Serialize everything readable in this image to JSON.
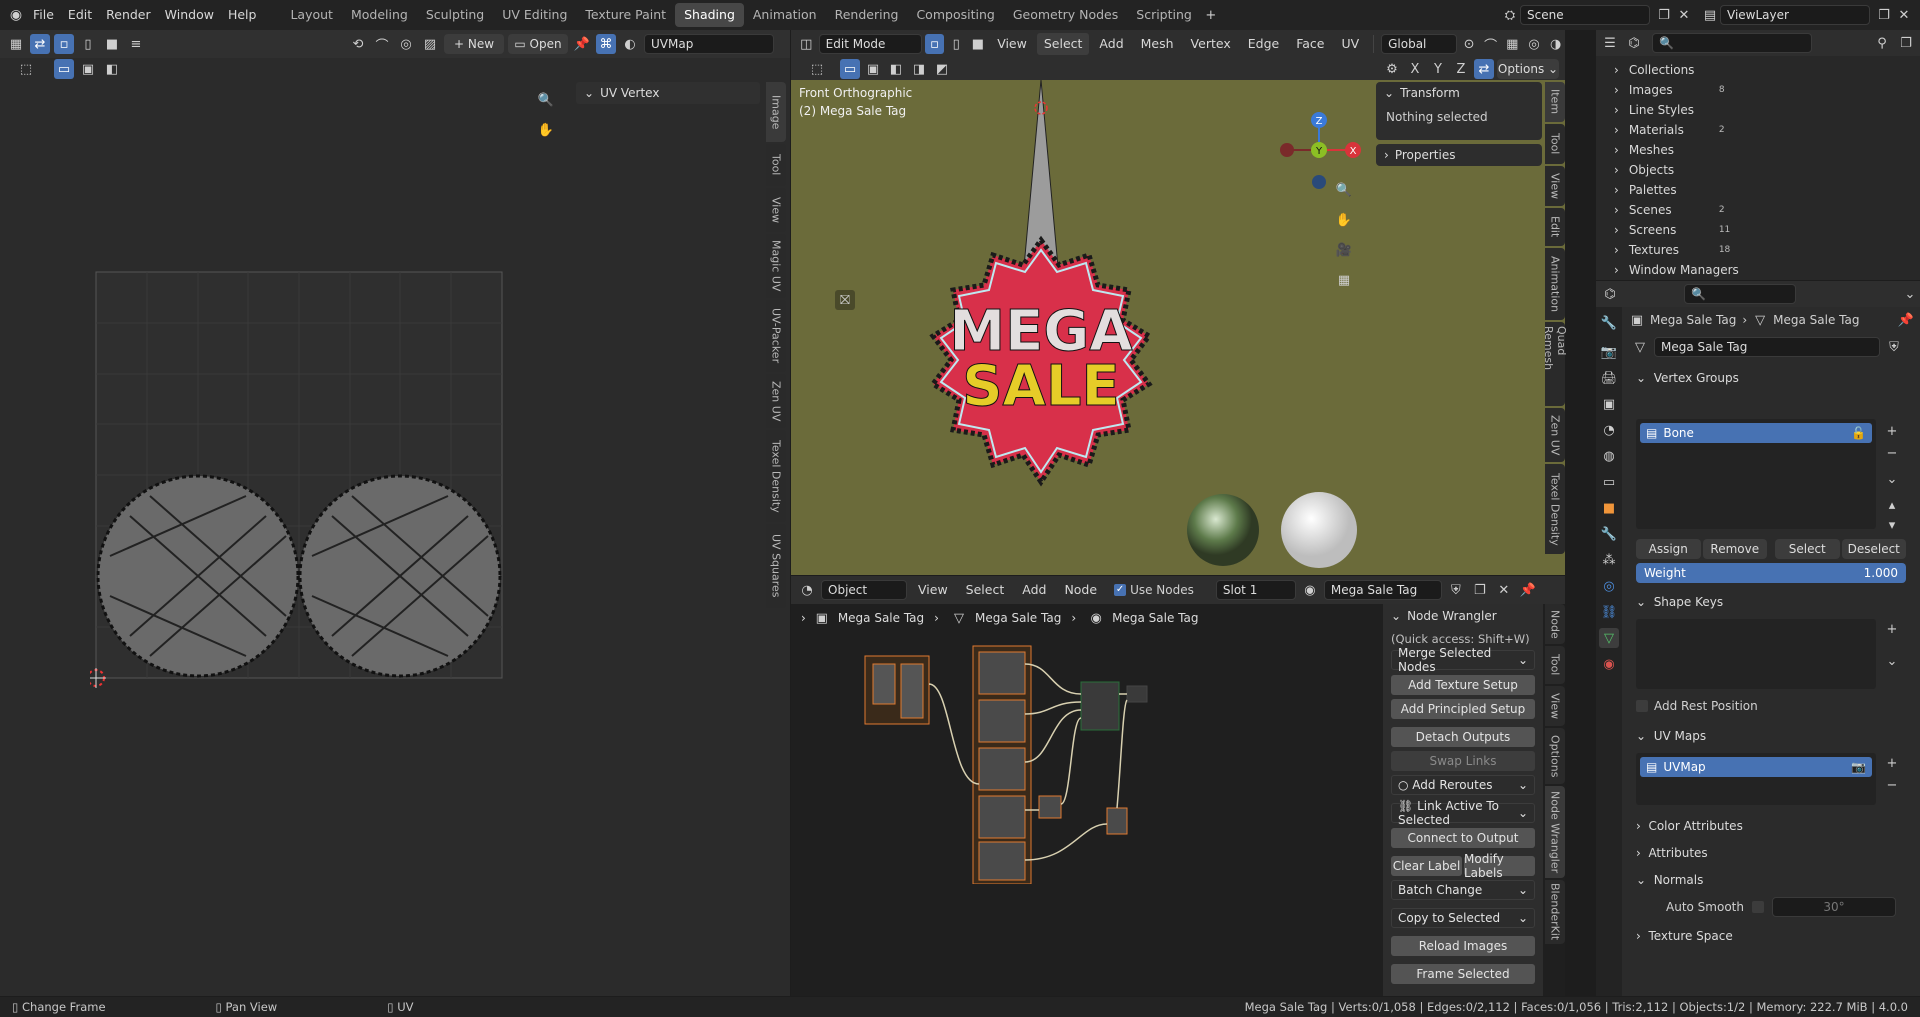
{
  "topbar": {
    "menus": [
      "File",
      "Edit",
      "Render",
      "Window",
      "Help"
    ],
    "workspaces": [
      "Layout",
      "Modeling",
      "Sculpting",
      "UV Editing",
      "Texture Paint",
      "Shading",
      "Animation",
      "Rendering",
      "Compositing",
      "Geometry Nodes",
      "Scripting"
    ],
    "active_workspace": "Shading",
    "scene_label": "Scene",
    "viewlayer_label": "ViewLayer"
  },
  "uv_editor": {
    "new_label": "New",
    "open_label": "Open",
    "uvmap_field": "UVMap",
    "side_panel_title": "UV Vertex",
    "side_tabs": [
      "Image",
      "Tool",
      "View",
      "Magic UV",
      "UV-Packer",
      "Zen UV",
      "Texel Density",
      "UV Squares"
    ]
  },
  "viewport": {
    "mode": "Edit Mode",
    "menus": [
      "View",
      "Select",
      "Add",
      "Mesh",
      "Vertex",
      "Edge",
      "Face",
      "UV"
    ],
    "transform_orientation": "Global",
    "options_label": "Options",
    "axis_x": "X",
    "axis_y": "Y",
    "axis_z": "Z",
    "view_name": "Front Orthographic",
    "object_name": "(2) Mega Sale Tag",
    "tag_text_top": "MEGA",
    "tag_text_bottom": "SALE",
    "transform_title": "Transform",
    "nothing_selected": "Nothing selected",
    "properties_title": "Properties",
    "side_tabs": [
      "Item",
      "Tool",
      "View",
      "Edit",
      "Animation",
      "Quad Remesh",
      "Zen UV",
      "Texel Density"
    ]
  },
  "node_editor": {
    "mode": "Object",
    "menus": [
      "View",
      "Select",
      "Add",
      "Node"
    ],
    "use_nodes_label": "Use Nodes",
    "slot": "Slot 1",
    "material": "Mega Sale Tag",
    "breadcrumb": [
      "Mega Sale Tag",
      "Mega Sale Tag",
      "Mega Sale Tag"
    ],
    "nw_title": "Node Wrangler",
    "nw_quick": "(Quick access: Shift+W)",
    "nw_merge": "Merge Selected Nodes",
    "nw_add_texture": "Add Texture Setup",
    "nw_add_principled": "Add Principled Setup",
    "nw_detach": "Detach Outputs",
    "nw_swap": "Swap Links",
    "nw_reroutes": "Add Reroutes",
    "nw_link_active": "Link Active To Selected",
    "nw_connect": "Connect to Output",
    "nw_clear_label": "Clear Label",
    "nw_modify_labels": "Modify Labels",
    "nw_batch": "Batch Change",
    "nw_copy": "Copy to Selected",
    "nw_reload": "Reload Images",
    "nw_frame": "Frame Selected",
    "side_tabs": [
      "Node",
      "Tool",
      "View",
      "Options",
      "Node Wrangler",
      "BlenderKit"
    ]
  },
  "outliner": {
    "items": [
      {
        "label": "Collections",
        "count": ""
      },
      {
        "label": "Images",
        "count": "8"
      },
      {
        "label": "Line Styles",
        "count": ""
      },
      {
        "label": "Materials",
        "count": "2"
      },
      {
        "label": "Meshes",
        "count": ""
      },
      {
        "label": "Objects",
        "count": ""
      },
      {
        "label": "Palettes",
        "count": ""
      },
      {
        "label": "Scenes",
        "count": "2"
      },
      {
        "label": "Screens",
        "count": "11"
      },
      {
        "label": "Textures",
        "count": "18"
      },
      {
        "label": "Window Managers",
        "count": ""
      }
    ]
  },
  "properties": {
    "breadcrumb_object": "Mega Sale Tag",
    "breadcrumb_mesh": "Mega Sale Tag",
    "mesh_name": "Mega Sale Tag",
    "vertex_groups_title": "Vertex Groups",
    "vertex_group_item": "Bone",
    "assign": "Assign",
    "remove": "Remove",
    "select": "Select",
    "deselect": "Deselect",
    "weight_label": "Weight",
    "weight_value": "1.000",
    "shape_keys_title": "Shape Keys",
    "add_rest_position": "Add Rest Position",
    "uv_maps_title": "UV Maps",
    "uv_map_item": "UVMap",
    "color_attributes": "Color Attributes",
    "attributes": "Attributes",
    "normals": "Normals",
    "auto_smooth": "Auto Smooth",
    "auto_smooth_angle": "30°",
    "texture_space": "Texture Space"
  },
  "statusbar": {
    "hint1": "Change Frame",
    "hint2": "Pan View",
    "hint3": "UV",
    "stats": "Mega Sale Tag | Verts:0/1,058 | Edges:0/2,112 | Faces:0/1,056 | Tris:2,112 | Objects:1/2 | Memory: 222.7 MiB | 4.0.0"
  },
  "colors": {
    "accent": "#4772b3",
    "tag_red": "#d8304a",
    "viewport_bg": "#6b6b3a",
    "sale_yellow": "#e6cc28"
  }
}
